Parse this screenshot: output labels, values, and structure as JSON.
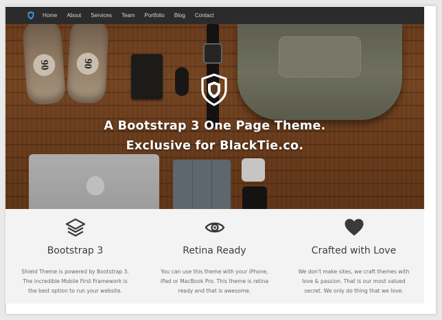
{
  "nav": {
    "links": [
      "Home",
      "About",
      "Services",
      "Team",
      "Portfolio",
      "Blog",
      "Contact"
    ]
  },
  "hero": {
    "title_line1": "A Bootstrap 3 One Page Theme.",
    "title_line2": "Exclusive for BlackTie.co.",
    "shoe_number": "90"
  },
  "features": [
    {
      "icon": "layers-icon",
      "title": "Bootstrap 3",
      "text": "Shield Theme is powered by Bootstrap 3. The incredible Mobile First Framework is the best option to run your website."
    },
    {
      "icon": "eye-icon",
      "title": "Retina Ready",
      "text": "You can use this theme with your iPhone, iPad or MacBook Pro. This theme is retina ready and that is awesome."
    },
    {
      "icon": "heart-icon",
      "title": "Crafted with Love",
      "text": "We don't make sites, we craft themes with love & passion. That is our most valued secret. We only do thing that we love."
    }
  ],
  "colors": {
    "nav_bg": "#2b2b2b",
    "logo_accent": "#3d8fd6",
    "icon_color": "#3a3a3a"
  }
}
